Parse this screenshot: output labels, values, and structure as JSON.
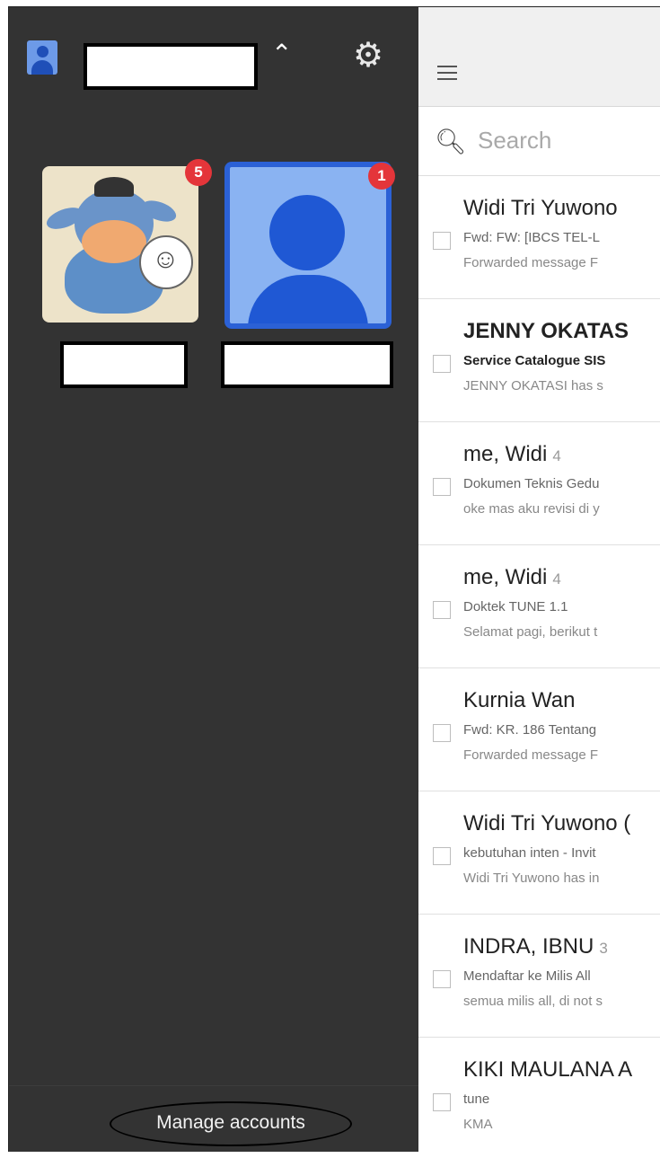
{
  "drawer": {
    "current_account": {
      "avatar_icon": "person-icon",
      "name": "",
      "switch_icon": "chevron-up-icon"
    },
    "settings_icon": "gear-icon",
    "accounts": [
      {
        "name": "",
        "unread": "5",
        "avatar": "eeyore-photo"
      },
      {
        "name": "",
        "unread": "1",
        "avatar": "default-person-icon"
      }
    ],
    "manage_label": "Manage accounts"
  },
  "inbox": {
    "menu_icon": "hamburger-menu-icon",
    "search": {
      "icon": "search-icon",
      "placeholder": "Search"
    },
    "messages": [
      {
        "sender": "Widi Tri Yuwono",
        "count": "",
        "subject": "Fwd: FW: [IBCS TEL-L",
        "snippet": "Forwarded message F",
        "unread": false
      },
      {
        "sender": "JENNY OKATAS",
        "count": "",
        "subject": "Service Catalogue SIS",
        "snippet": "JENNY OKATASI has s",
        "unread": true
      },
      {
        "sender": "me, Widi",
        "count": "4",
        "subject": "Dokumen Teknis Gedu",
        "snippet": "oke mas aku revisi di y",
        "unread": false
      },
      {
        "sender": "me, Widi",
        "count": "4",
        "subject": "Doktek TUNE 1.1",
        "snippet": "Selamat pagi, berikut t",
        "unread": false
      },
      {
        "sender": "Kurnia Wan",
        "count": "",
        "subject": "Fwd: KR. 186 Tentang",
        "snippet": "Forwarded message F",
        "unread": false
      },
      {
        "sender": "Widi Tri Yuwono (",
        "count": "",
        "subject": "kebutuhan inten - Invit",
        "snippet": "Widi Tri Yuwono has in",
        "unread": false
      },
      {
        "sender": "INDRA, IBNU",
        "count": "3",
        "subject": "Mendaftar ke Milis All",
        "snippet": "semua milis all, di not s",
        "unread": false
      },
      {
        "sender": "KIKI MAULANA A",
        "count": "",
        "subject": "tune",
        "snippet": "KMA",
        "unread": false
      }
    ]
  },
  "colors": {
    "drawer_bg": "#333333",
    "badge": "#e4353a",
    "accent_blue": "#2b61d6"
  }
}
